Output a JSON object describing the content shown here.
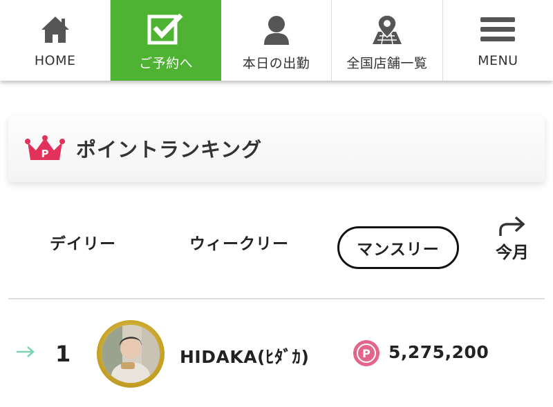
{
  "nav": {
    "items": [
      {
        "label": "HOME",
        "icon": "home-icon"
      },
      {
        "label": "ご予約へ",
        "icon": "checkbox-icon",
        "active": true
      },
      {
        "label": "本日の出勤",
        "icon": "person-icon"
      },
      {
        "label": "全国店舗一覧",
        "icon": "map-pin-icon"
      },
      {
        "label": "MENU",
        "icon": "hamburger-icon"
      }
    ],
    "active_color": "#4eb232"
  },
  "heading": {
    "title": "ポイントランキング",
    "icon": "crown-icon",
    "icon_color": "#e0325b"
  },
  "tabs": {
    "daily": "デイリー",
    "weekly": "ウィークリー",
    "monthly": "マンスリー",
    "selected": "monthly",
    "next_label": "今月"
  },
  "ranking": [
    {
      "trend": "right-arrow-icon",
      "trend_color": "#7dd3b0",
      "rank": "1",
      "name": "HIDAKA(ﾋﾀﾞｶ)",
      "points": "5,275,200",
      "points_icon_color": "#e4658a"
    }
  ]
}
